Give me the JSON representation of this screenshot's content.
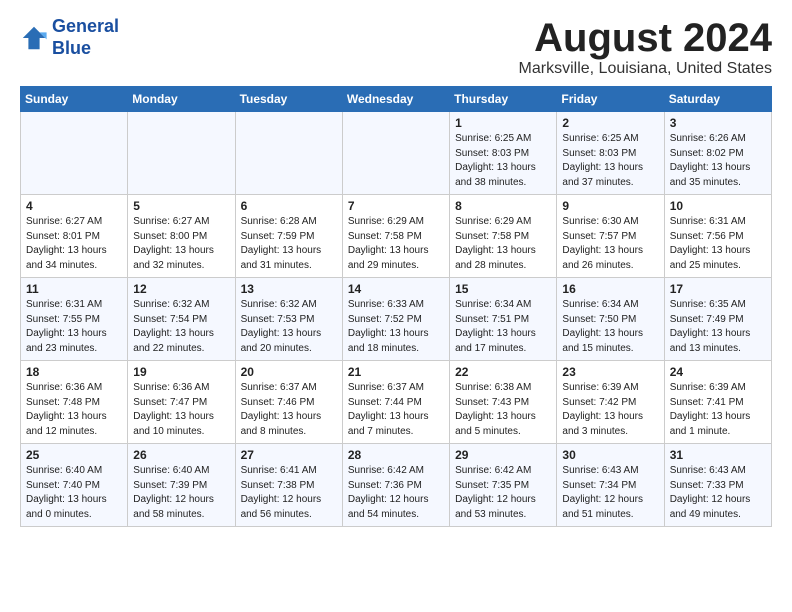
{
  "logo": {
    "line1": "General",
    "line2": "Blue"
  },
  "title": "August 2024",
  "location": "Marksville, Louisiana, United States",
  "days_of_week": [
    "Sunday",
    "Monday",
    "Tuesday",
    "Wednesday",
    "Thursday",
    "Friday",
    "Saturday"
  ],
  "weeks": [
    [
      {
        "day": "",
        "info": ""
      },
      {
        "day": "",
        "info": ""
      },
      {
        "day": "",
        "info": ""
      },
      {
        "day": "",
        "info": ""
      },
      {
        "day": "1",
        "info": "Sunrise: 6:25 AM\nSunset: 8:03 PM\nDaylight: 13 hours\nand 38 minutes."
      },
      {
        "day": "2",
        "info": "Sunrise: 6:25 AM\nSunset: 8:03 PM\nDaylight: 13 hours\nand 37 minutes."
      },
      {
        "day": "3",
        "info": "Sunrise: 6:26 AM\nSunset: 8:02 PM\nDaylight: 13 hours\nand 35 minutes."
      }
    ],
    [
      {
        "day": "4",
        "info": "Sunrise: 6:27 AM\nSunset: 8:01 PM\nDaylight: 13 hours\nand 34 minutes."
      },
      {
        "day": "5",
        "info": "Sunrise: 6:27 AM\nSunset: 8:00 PM\nDaylight: 13 hours\nand 32 minutes."
      },
      {
        "day": "6",
        "info": "Sunrise: 6:28 AM\nSunset: 7:59 PM\nDaylight: 13 hours\nand 31 minutes."
      },
      {
        "day": "7",
        "info": "Sunrise: 6:29 AM\nSunset: 7:58 PM\nDaylight: 13 hours\nand 29 minutes."
      },
      {
        "day": "8",
        "info": "Sunrise: 6:29 AM\nSunset: 7:58 PM\nDaylight: 13 hours\nand 28 minutes."
      },
      {
        "day": "9",
        "info": "Sunrise: 6:30 AM\nSunset: 7:57 PM\nDaylight: 13 hours\nand 26 minutes."
      },
      {
        "day": "10",
        "info": "Sunrise: 6:31 AM\nSunset: 7:56 PM\nDaylight: 13 hours\nand 25 minutes."
      }
    ],
    [
      {
        "day": "11",
        "info": "Sunrise: 6:31 AM\nSunset: 7:55 PM\nDaylight: 13 hours\nand 23 minutes."
      },
      {
        "day": "12",
        "info": "Sunrise: 6:32 AM\nSunset: 7:54 PM\nDaylight: 13 hours\nand 22 minutes."
      },
      {
        "day": "13",
        "info": "Sunrise: 6:32 AM\nSunset: 7:53 PM\nDaylight: 13 hours\nand 20 minutes."
      },
      {
        "day": "14",
        "info": "Sunrise: 6:33 AM\nSunset: 7:52 PM\nDaylight: 13 hours\nand 18 minutes."
      },
      {
        "day": "15",
        "info": "Sunrise: 6:34 AM\nSunset: 7:51 PM\nDaylight: 13 hours\nand 17 minutes."
      },
      {
        "day": "16",
        "info": "Sunrise: 6:34 AM\nSunset: 7:50 PM\nDaylight: 13 hours\nand 15 minutes."
      },
      {
        "day": "17",
        "info": "Sunrise: 6:35 AM\nSunset: 7:49 PM\nDaylight: 13 hours\nand 13 minutes."
      }
    ],
    [
      {
        "day": "18",
        "info": "Sunrise: 6:36 AM\nSunset: 7:48 PM\nDaylight: 13 hours\nand 12 minutes."
      },
      {
        "day": "19",
        "info": "Sunrise: 6:36 AM\nSunset: 7:47 PM\nDaylight: 13 hours\nand 10 minutes."
      },
      {
        "day": "20",
        "info": "Sunrise: 6:37 AM\nSunset: 7:46 PM\nDaylight: 13 hours\nand 8 minutes."
      },
      {
        "day": "21",
        "info": "Sunrise: 6:37 AM\nSunset: 7:44 PM\nDaylight: 13 hours\nand 7 minutes."
      },
      {
        "day": "22",
        "info": "Sunrise: 6:38 AM\nSunset: 7:43 PM\nDaylight: 13 hours\nand 5 minutes."
      },
      {
        "day": "23",
        "info": "Sunrise: 6:39 AM\nSunset: 7:42 PM\nDaylight: 13 hours\nand 3 minutes."
      },
      {
        "day": "24",
        "info": "Sunrise: 6:39 AM\nSunset: 7:41 PM\nDaylight: 13 hours\nand 1 minute."
      }
    ],
    [
      {
        "day": "25",
        "info": "Sunrise: 6:40 AM\nSunset: 7:40 PM\nDaylight: 13 hours\nand 0 minutes."
      },
      {
        "day": "26",
        "info": "Sunrise: 6:40 AM\nSunset: 7:39 PM\nDaylight: 12 hours\nand 58 minutes."
      },
      {
        "day": "27",
        "info": "Sunrise: 6:41 AM\nSunset: 7:38 PM\nDaylight: 12 hours\nand 56 minutes."
      },
      {
        "day": "28",
        "info": "Sunrise: 6:42 AM\nSunset: 7:36 PM\nDaylight: 12 hours\nand 54 minutes."
      },
      {
        "day": "29",
        "info": "Sunrise: 6:42 AM\nSunset: 7:35 PM\nDaylight: 12 hours\nand 53 minutes."
      },
      {
        "day": "30",
        "info": "Sunrise: 6:43 AM\nSunset: 7:34 PM\nDaylight: 12 hours\nand 51 minutes."
      },
      {
        "day": "31",
        "info": "Sunrise: 6:43 AM\nSunset: 7:33 PM\nDaylight: 12 hours\nand 49 minutes."
      }
    ]
  ]
}
